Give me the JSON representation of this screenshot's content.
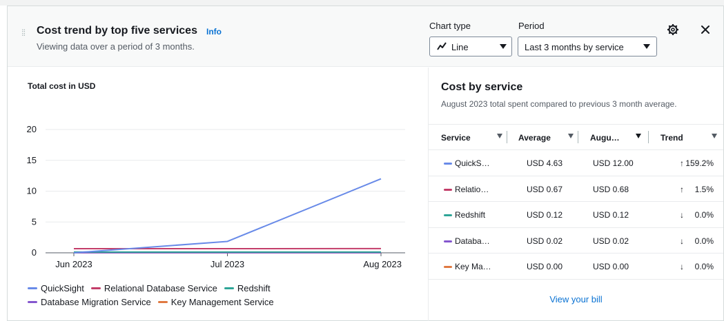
{
  "header": {
    "title": "Cost trend by top five services",
    "info_label": "Info",
    "subtitle": "Viewing data over a period of 3 months.",
    "chart_type": {
      "label": "Chart type",
      "value": "Line"
    },
    "period": {
      "label": "Period",
      "value": "Last 3 months by service"
    }
  },
  "chart": {
    "heading": "Total cost in USD"
  },
  "chart_data": {
    "type": "line",
    "title": "Total cost in USD",
    "xlabel": "",
    "ylabel": "",
    "x": [
      "Jun 2023",
      "Jul 2023",
      "Aug 2023"
    ],
    "yticks": [
      0,
      5,
      10,
      15,
      20
    ],
    "ylim": [
      0,
      20
    ],
    "grid": true,
    "legend_position": "bottom",
    "series": [
      {
        "name": "QuickSight",
        "color": "#688ae8",
        "values": [
          0,
          1.85,
          12.0
        ]
      },
      {
        "name": "Relational Database Service",
        "color": "#c33d69",
        "values": [
          0.67,
          0.67,
          0.68
        ]
      },
      {
        "name": "Redshift",
        "color": "#2ea597",
        "values": [
          0.12,
          0.12,
          0.12
        ]
      },
      {
        "name": "Database Migration Service",
        "color": "#8456ce",
        "values": [
          0.02,
          0.02,
          0.02
        ]
      },
      {
        "name": "Key Management Service",
        "color": "#e07941",
        "values": [
          0.0,
          0.0,
          0.0
        ]
      }
    ]
  },
  "panel": {
    "title": "Cost by service",
    "subtitle": "August 2023 total spent compared to previous 3 month average.",
    "columns": [
      "Service",
      "Average",
      "Augu…",
      "Trend"
    ],
    "rows": [
      {
        "service": "QuickS…",
        "color": "#688ae8",
        "average": "USD 4.63",
        "august": "USD 12.00",
        "arrow": "↑",
        "trend": "159.2%"
      },
      {
        "service": "Relatio…",
        "color": "#c33d69",
        "average": "USD 0.67",
        "august": "USD 0.68",
        "arrow": "↑",
        "trend": "1.5%"
      },
      {
        "service": "Redshift",
        "color": "#2ea597",
        "average": "USD 0.12",
        "august": "USD 0.12",
        "arrow": "↓",
        "trend": "0.0%"
      },
      {
        "service": "Databa…",
        "color": "#8456ce",
        "average": "USD 0.02",
        "august": "USD 0.02",
        "arrow": "↓",
        "trend": "0.0%"
      },
      {
        "service": "Key Ma…",
        "color": "#e07941",
        "average": "USD 0.00",
        "august": "USD 0.00",
        "arrow": "↓",
        "trend": "0.0%"
      }
    ],
    "footer_link": "View your bill"
  }
}
